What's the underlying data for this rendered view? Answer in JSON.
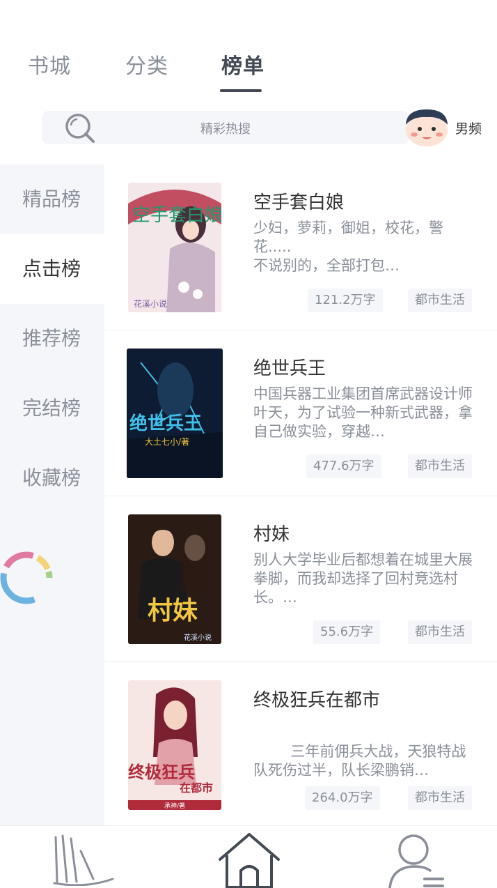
{
  "top_tabs": [
    {
      "label": "书城",
      "active": false
    },
    {
      "label": "分类",
      "active": false
    },
    {
      "label": "榜单",
      "active": true
    }
  ],
  "search": {
    "placeholder": "精彩热搜"
  },
  "gender": {
    "label": "男频"
  },
  "sidebar": {
    "items": [
      {
        "label": "精品榜",
        "active": false
      },
      {
        "label": "点击榜",
        "active": true
      },
      {
        "label": "推荐榜",
        "active": false
      },
      {
        "label": "完结榜",
        "active": false
      },
      {
        "label": "收藏榜",
        "active": false
      }
    ]
  },
  "books": [
    {
      "title": "空手套白娘",
      "description": "少妇，萝莉，御姐，校花，警花.....\n不说别的，全部打包…",
      "word_count": "121.2万字",
      "category": "都市生活",
      "cover_colors": [
        "#f3e7ea",
        "#b8324a",
        "#5a3a4a"
      ]
    },
    {
      "title": "绝世兵王",
      "description": "中国兵器工业集团首席武器设计师叶天，为了试验一种新式武器，拿自己做实验，穿越…",
      "word_count": "477.6万字",
      "category": "都市生活",
      "cover_colors": [
        "#0d1c33",
        "#1b6fa8",
        "#3fc0e8"
      ]
    },
    {
      "title": "村妹",
      "description": "别人大学毕业后都想着在城里大展拳脚，而我却选择了回村竞选村长。…",
      "word_count": "55.6万字",
      "category": "都市生活",
      "cover_colors": [
        "#2a1b14",
        "#8a5a2a",
        "#e0b04a"
      ]
    },
    {
      "title": "终极狂兵在都市",
      "description": "\n        三年前佣兵大战，天狼特战队死伤过半，队长梁鹏销…",
      "word_count": "264.0万字",
      "category": "都市生活",
      "cover_colors": [
        "#f6e6e4",
        "#b02a3a",
        "#7a2030"
      ]
    }
  ],
  "cover_text": {
    "book1": "空手套白娘",
    "book1_author": "花溪小说",
    "book2": "绝世兵王",
    "book2_author": "大土七小/著",
    "book3": "村妹",
    "book3_author": "花溪小说",
    "book4": "终极狂兵",
    "book4_sub": "在都市",
    "book4_author": "承神/著"
  },
  "bottom_nav": [
    {
      "icon": "bookshelf-icon"
    },
    {
      "icon": "home-icon"
    },
    {
      "icon": "user-icon"
    }
  ],
  "colors": {
    "accent": "#444a54",
    "muted": "#8a8f99",
    "panel": "#f5f6fa"
  }
}
